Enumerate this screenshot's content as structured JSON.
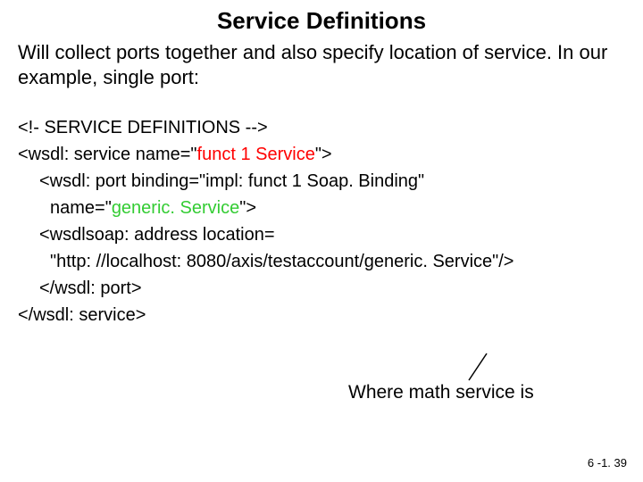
{
  "title": "Service Definitions",
  "intro": "Will collect ports together and also specify location of service. In our example, single port:",
  "code": {
    "l1": "<!- SERVICE DEFINITIONS -->",
    "l2a": "<wsdl: service name=\"",
    "l2b": "funct 1 Service",
    "l2c": "\">",
    "l3": "<wsdl: port binding=\"impl: funct 1 Soap. Binding\"",
    "l4a": "name=\"",
    "l4b": "generic. Service",
    "l4c": "\">",
    "l5": "<wsdlsoap: address location=",
    "l6": "\"http: //localhost: 8080/axis/testaccount/generic. Service\"/>",
    "l7": "</wsdl: port>",
    "l8": "</wsdl: service>"
  },
  "annotation": "Where math service is",
  "pagenum": "6 -1. 39"
}
